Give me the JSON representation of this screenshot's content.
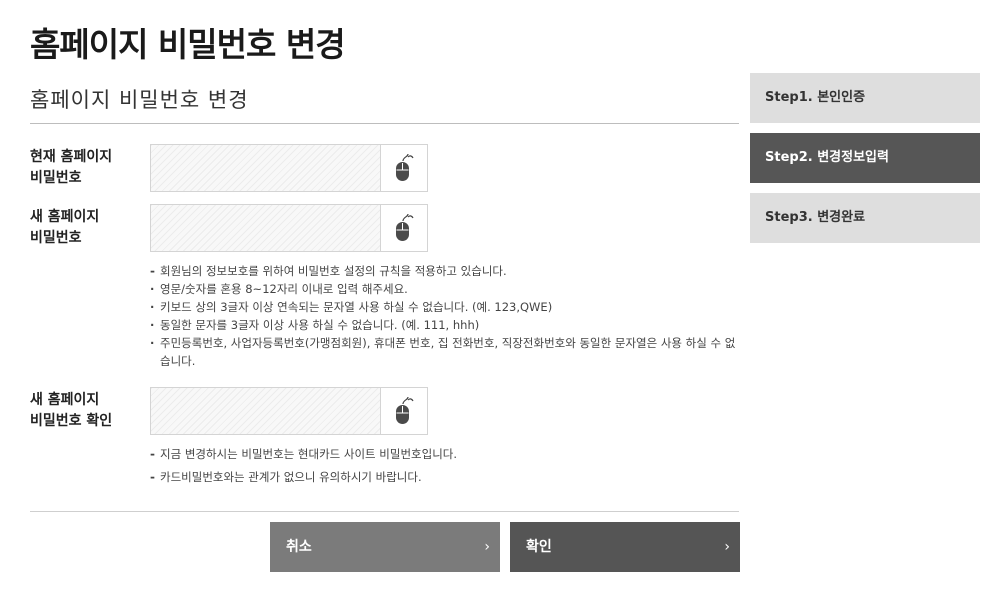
{
  "page_title": "홈페이지 비밀번호 변경",
  "section_title": "홈페이지 비밀번호 변경",
  "fields": [
    {
      "label_line1": "현재 홈페이지",
      "label_line2": "비밀번호"
    },
    {
      "label_line1": "새 홈페이지",
      "label_line2": "비밀번호"
    },
    {
      "label_line1": "새 홈페이지",
      "label_line2": "비밀번호 확인"
    }
  ],
  "notes_new_password": {
    "main": "회원님의 정보보호를 위하여 비밀번호 설정의 규칙을 적용하고 있습니다.",
    "rules": [
      "영문/숫자를 혼용 8~12자리 이내로 입력 해주세요.",
      "키보드 상의 3글자 이상 연속되는 문자열 사용 하실 수 없습니다. (예. 123,QWE)",
      "동일한 문자를 3글자 이상 사용 하실 수 없습니다. (예. 111, hhh)",
      "주민등록번호, 사업자등록번호(가맹점회원), 휴대폰 번호, 집 전화번호, 직장전화번호와 동일한 문자열은 사용 하실 수 없습니다."
    ]
  },
  "notes_confirm": [
    "지금 변경하시는 비밀번호는 현대카드 사이트 비밀번호입니다.",
    "카드비밀번호와는 관계가 없으니 유의하시기 바랍니다."
  ],
  "buttons": {
    "cancel": "취소",
    "confirm": "확인",
    "chevron": "›"
  },
  "steps": [
    {
      "label": "Step1. 본인인증",
      "active": false
    },
    {
      "label": "Step2. 변경정보입력",
      "active": true
    },
    {
      "label": "Step3. 변경완료",
      "active": false
    }
  ],
  "icons": {
    "virtual_keyboard": "mouse-icon"
  },
  "colors": {
    "active_step": "#565656",
    "inactive_step": "#dedede",
    "cancel_button": "#7b7b7b",
    "confirm_button": "#555555"
  }
}
